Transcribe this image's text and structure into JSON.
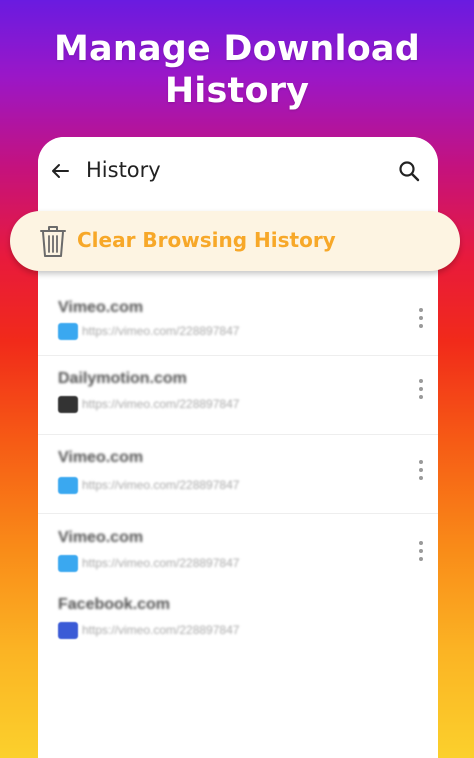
{
  "headline": {
    "line1": "Manage Download",
    "line2": "History"
  },
  "app_bar": {
    "title": "History",
    "back_icon": "arrow-left-icon",
    "search_icon": "search-icon"
  },
  "clear_banner": {
    "label": "Clear Browsing History",
    "icon": "trash-icon",
    "accent": "#f7a829"
  },
  "history": [
    {
      "title": "Vimeo.com",
      "url": "https://vimeo.com/228897847",
      "icon": "vimeo-icon",
      "icon_color": "#3aa8f0",
      "has_menu": true
    },
    {
      "title": "Dailymotion.com",
      "url": "https://vimeo.com/228897847",
      "icon": "dailymotion-icon",
      "icon_color": "#333333",
      "has_menu": true
    },
    {
      "title": "Vimeo.com",
      "url": "https://vimeo.com/228897847",
      "icon": "vimeo-icon",
      "icon_color": "#3aa8f0",
      "has_menu": true
    },
    {
      "title": "Vimeo.com",
      "url": "https://vimeo.com/228897847",
      "icon": "vimeo-icon",
      "icon_color": "#3aa8f0",
      "has_menu": true
    },
    {
      "title": "Facebook.com",
      "url": "https://vimeo.com/228897847",
      "icon": "facebook-icon",
      "icon_color": "#3b5bd6",
      "has_menu": false
    }
  ]
}
